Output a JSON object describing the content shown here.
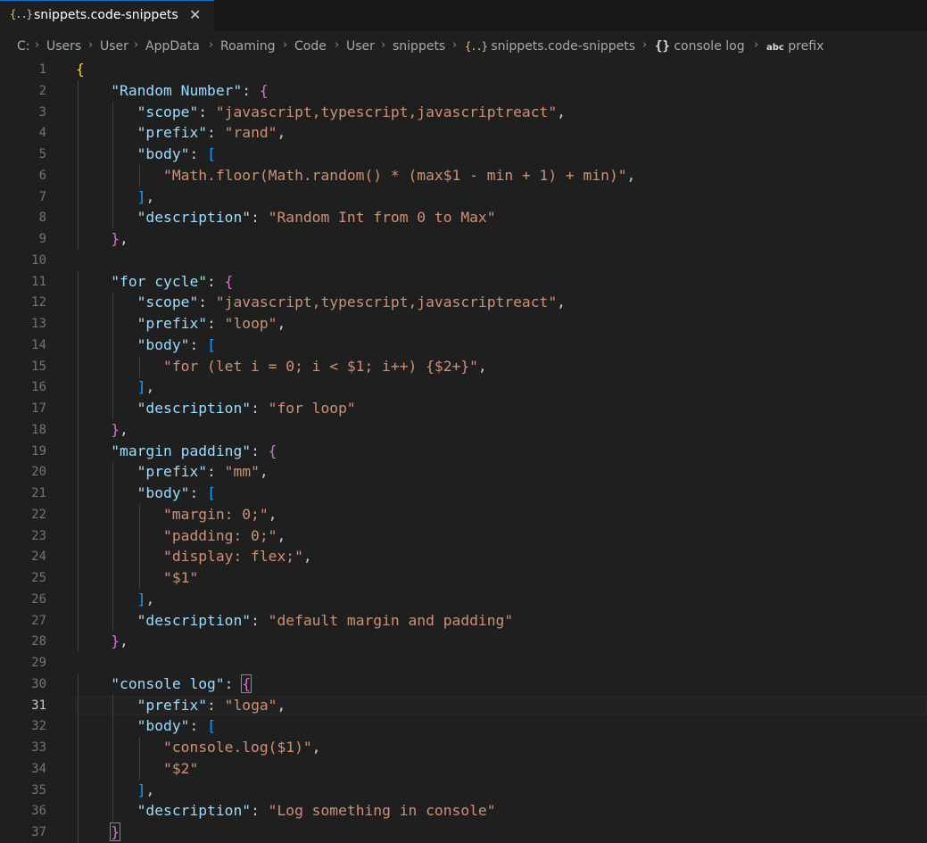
{
  "tab": {
    "icon": "{..}",
    "label": "snippets.code-snippets",
    "close_icon": "✕"
  },
  "breadcrumb": {
    "items": [
      {
        "label": "C:"
      },
      {
        "label": "Users"
      },
      {
        "label": "User"
      },
      {
        "label": "AppData"
      },
      {
        "label": "Roaming"
      },
      {
        "label": "Code"
      },
      {
        "label": "User"
      },
      {
        "label": "snippets"
      },
      {
        "label": "snippets.code-snippets",
        "icon": "{..}"
      },
      {
        "label": "console log",
        "icon": "{}"
      },
      {
        "label": "prefix",
        "icon": "abc"
      }
    ],
    "separator": "›"
  },
  "editor": {
    "active_line": 31,
    "lines": [
      {
        "n": "1",
        "t": [
          {
            "c": "b1",
            "v": "{"
          }
        ]
      },
      {
        "n": "2",
        "t": [
          {
            "c": "p",
            "v": "    "
          },
          {
            "c": "key",
            "v": "\"Random Number\""
          },
          {
            "c": "p",
            "v": ": "
          },
          {
            "c": "b2",
            "v": "{"
          }
        ]
      },
      {
        "n": "3",
        "t": [
          {
            "c": "p",
            "v": "       "
          },
          {
            "c": "key",
            "v": "\"scope\""
          },
          {
            "c": "p",
            "v": ": "
          },
          {
            "c": "str",
            "v": "\"javascript,typescript,javascriptreact\""
          },
          {
            "c": "p",
            "v": ","
          }
        ]
      },
      {
        "n": "4",
        "t": [
          {
            "c": "p",
            "v": "       "
          },
          {
            "c": "key",
            "v": "\"prefix\""
          },
          {
            "c": "p",
            "v": ": "
          },
          {
            "c": "str",
            "v": "\"rand\""
          },
          {
            "c": "p",
            "v": ","
          }
        ]
      },
      {
        "n": "5",
        "t": [
          {
            "c": "p",
            "v": "       "
          },
          {
            "c": "key",
            "v": "\"body\""
          },
          {
            "c": "p",
            "v": ": "
          },
          {
            "c": "b3",
            "v": "["
          }
        ]
      },
      {
        "n": "6",
        "t": [
          {
            "c": "p",
            "v": "          "
          },
          {
            "c": "str",
            "v": "\"Math.floor(Math.random() * (max$1 - min + 1) + min)\""
          },
          {
            "c": "p",
            "v": ","
          }
        ]
      },
      {
        "n": "7",
        "t": [
          {
            "c": "p",
            "v": "       "
          },
          {
            "c": "b3",
            "v": "]"
          },
          {
            "c": "p",
            "v": ","
          }
        ]
      },
      {
        "n": "8",
        "t": [
          {
            "c": "p",
            "v": "       "
          },
          {
            "c": "key",
            "v": "\"description\""
          },
          {
            "c": "p",
            "v": ": "
          },
          {
            "c": "str",
            "v": "\"Random Int from 0 to Max\""
          }
        ]
      },
      {
        "n": "9",
        "t": [
          {
            "c": "p",
            "v": "    "
          },
          {
            "c": "b2",
            "v": "}"
          },
          {
            "c": "p",
            "v": ","
          }
        ]
      },
      {
        "n": "10",
        "t": []
      },
      {
        "n": "11",
        "t": [
          {
            "c": "p",
            "v": "    "
          },
          {
            "c": "key",
            "v": "\"for cycle\""
          },
          {
            "c": "p",
            "v": ": "
          },
          {
            "c": "b2",
            "v": "{"
          }
        ]
      },
      {
        "n": "12",
        "t": [
          {
            "c": "p",
            "v": "       "
          },
          {
            "c": "key",
            "v": "\"scope\""
          },
          {
            "c": "p",
            "v": ": "
          },
          {
            "c": "str",
            "v": "\"javascript,typescript,javascriptreact\""
          },
          {
            "c": "p",
            "v": ","
          }
        ]
      },
      {
        "n": "13",
        "t": [
          {
            "c": "p",
            "v": "       "
          },
          {
            "c": "key",
            "v": "\"prefix\""
          },
          {
            "c": "p",
            "v": ": "
          },
          {
            "c": "str",
            "v": "\"loop\""
          },
          {
            "c": "p",
            "v": ","
          }
        ]
      },
      {
        "n": "14",
        "t": [
          {
            "c": "p",
            "v": "       "
          },
          {
            "c": "key",
            "v": "\"body\""
          },
          {
            "c": "p",
            "v": ": "
          },
          {
            "c": "b3",
            "v": "["
          }
        ]
      },
      {
        "n": "15",
        "t": [
          {
            "c": "p",
            "v": "          "
          },
          {
            "c": "str",
            "v": "\"for (let i = 0; i < $1; i++) {$2+}\""
          },
          {
            "c": "p",
            "v": ","
          }
        ]
      },
      {
        "n": "16",
        "t": [
          {
            "c": "p",
            "v": "       "
          },
          {
            "c": "b3",
            "v": "]"
          },
          {
            "c": "p",
            "v": ","
          }
        ]
      },
      {
        "n": "17",
        "t": [
          {
            "c": "p",
            "v": "       "
          },
          {
            "c": "key",
            "v": "\"description\""
          },
          {
            "c": "p",
            "v": ": "
          },
          {
            "c": "str",
            "v": "\"for loop\""
          }
        ]
      },
      {
        "n": "18",
        "t": [
          {
            "c": "p",
            "v": "    "
          },
          {
            "c": "b2",
            "v": "}"
          },
          {
            "c": "p",
            "v": ","
          }
        ]
      },
      {
        "n": "19",
        "t": [
          {
            "c": "p",
            "v": "    "
          },
          {
            "c": "key",
            "v": "\"margin padding\""
          },
          {
            "c": "p",
            "v": ": "
          },
          {
            "c": "b2",
            "v": "{"
          }
        ]
      },
      {
        "n": "20",
        "t": [
          {
            "c": "p",
            "v": "       "
          },
          {
            "c": "key",
            "v": "\"prefix\""
          },
          {
            "c": "p",
            "v": ": "
          },
          {
            "c": "str",
            "v": "\"mm\""
          },
          {
            "c": "p",
            "v": ","
          }
        ]
      },
      {
        "n": "21",
        "t": [
          {
            "c": "p",
            "v": "       "
          },
          {
            "c": "key",
            "v": "\"body\""
          },
          {
            "c": "p",
            "v": ": "
          },
          {
            "c": "b3",
            "v": "["
          }
        ]
      },
      {
        "n": "22",
        "t": [
          {
            "c": "p",
            "v": "          "
          },
          {
            "c": "str",
            "v": "\"margin: 0;\""
          },
          {
            "c": "p",
            "v": ","
          }
        ]
      },
      {
        "n": "23",
        "t": [
          {
            "c": "p",
            "v": "          "
          },
          {
            "c": "str",
            "v": "\"padding: 0;\""
          },
          {
            "c": "p",
            "v": ","
          }
        ]
      },
      {
        "n": "24",
        "t": [
          {
            "c": "p",
            "v": "          "
          },
          {
            "c": "str",
            "v": "\"display: flex;\""
          },
          {
            "c": "p",
            "v": ","
          }
        ]
      },
      {
        "n": "25",
        "t": [
          {
            "c": "p",
            "v": "          "
          },
          {
            "c": "str",
            "v": "\"$1\""
          }
        ]
      },
      {
        "n": "26",
        "t": [
          {
            "c": "p",
            "v": "       "
          },
          {
            "c": "b3",
            "v": "]"
          },
          {
            "c": "p",
            "v": ","
          }
        ]
      },
      {
        "n": "27",
        "t": [
          {
            "c": "p",
            "v": "       "
          },
          {
            "c": "key",
            "v": "\"description\""
          },
          {
            "c": "p",
            "v": ": "
          },
          {
            "c": "str",
            "v": "\"default margin and padding\""
          }
        ]
      },
      {
        "n": "28",
        "t": [
          {
            "c": "p",
            "v": "    "
          },
          {
            "c": "b2",
            "v": "}"
          },
          {
            "c": "p",
            "v": ","
          }
        ]
      },
      {
        "n": "29",
        "t": []
      },
      {
        "n": "30",
        "t": [
          {
            "c": "p",
            "v": "    "
          },
          {
            "c": "key",
            "v": "\"console log\""
          },
          {
            "c": "p",
            "v": ": "
          },
          {
            "c": "b2m",
            "v": "{"
          }
        ]
      },
      {
        "n": "31",
        "t": [
          {
            "c": "p",
            "v": "       "
          },
          {
            "c": "key",
            "v": "\"prefix\""
          },
          {
            "c": "p",
            "v": ": "
          },
          {
            "c": "str",
            "v": "\"loga\""
          },
          {
            "c": "p",
            "v": ","
          }
        ]
      },
      {
        "n": "32",
        "t": [
          {
            "c": "p",
            "v": "       "
          },
          {
            "c": "key",
            "v": "\"body\""
          },
          {
            "c": "p",
            "v": ": "
          },
          {
            "c": "b3",
            "v": "["
          }
        ]
      },
      {
        "n": "33",
        "t": [
          {
            "c": "p",
            "v": "          "
          },
          {
            "c": "str",
            "v": "\"console.log($1)\""
          },
          {
            "c": "p",
            "v": ","
          }
        ]
      },
      {
        "n": "34",
        "t": [
          {
            "c": "p",
            "v": "          "
          },
          {
            "c": "str",
            "v": "\"$2\""
          }
        ]
      },
      {
        "n": "35",
        "t": [
          {
            "c": "p",
            "v": "       "
          },
          {
            "c": "b3",
            "v": "]"
          },
          {
            "c": "p",
            "v": ","
          }
        ]
      },
      {
        "n": "36",
        "t": [
          {
            "c": "p",
            "v": "       "
          },
          {
            "c": "key",
            "v": "\"description\""
          },
          {
            "c": "p",
            "v": ": "
          },
          {
            "c": "str",
            "v": "\"Log something in console\""
          }
        ]
      },
      {
        "n": "37",
        "t": [
          {
            "c": "p",
            "v": "    "
          },
          {
            "c": "b2m",
            "v": "}"
          }
        ]
      }
    ]
  }
}
